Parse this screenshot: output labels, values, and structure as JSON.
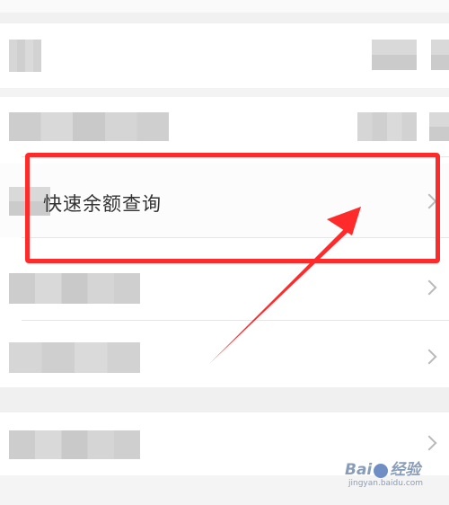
{
  "menu": {
    "highlighted_item": {
      "label": "快速余额查询"
    }
  },
  "watermark": {
    "brand": "Bai",
    "brand_suffix": "经验",
    "url": "jingyan.baidu.com"
  },
  "colors": {
    "highlight": "#ff2a2a",
    "arrow": "#ff2a2a"
  },
  "icons": {
    "chevron": "chevron-right-icon",
    "paw": "baidu-paw-icon"
  }
}
